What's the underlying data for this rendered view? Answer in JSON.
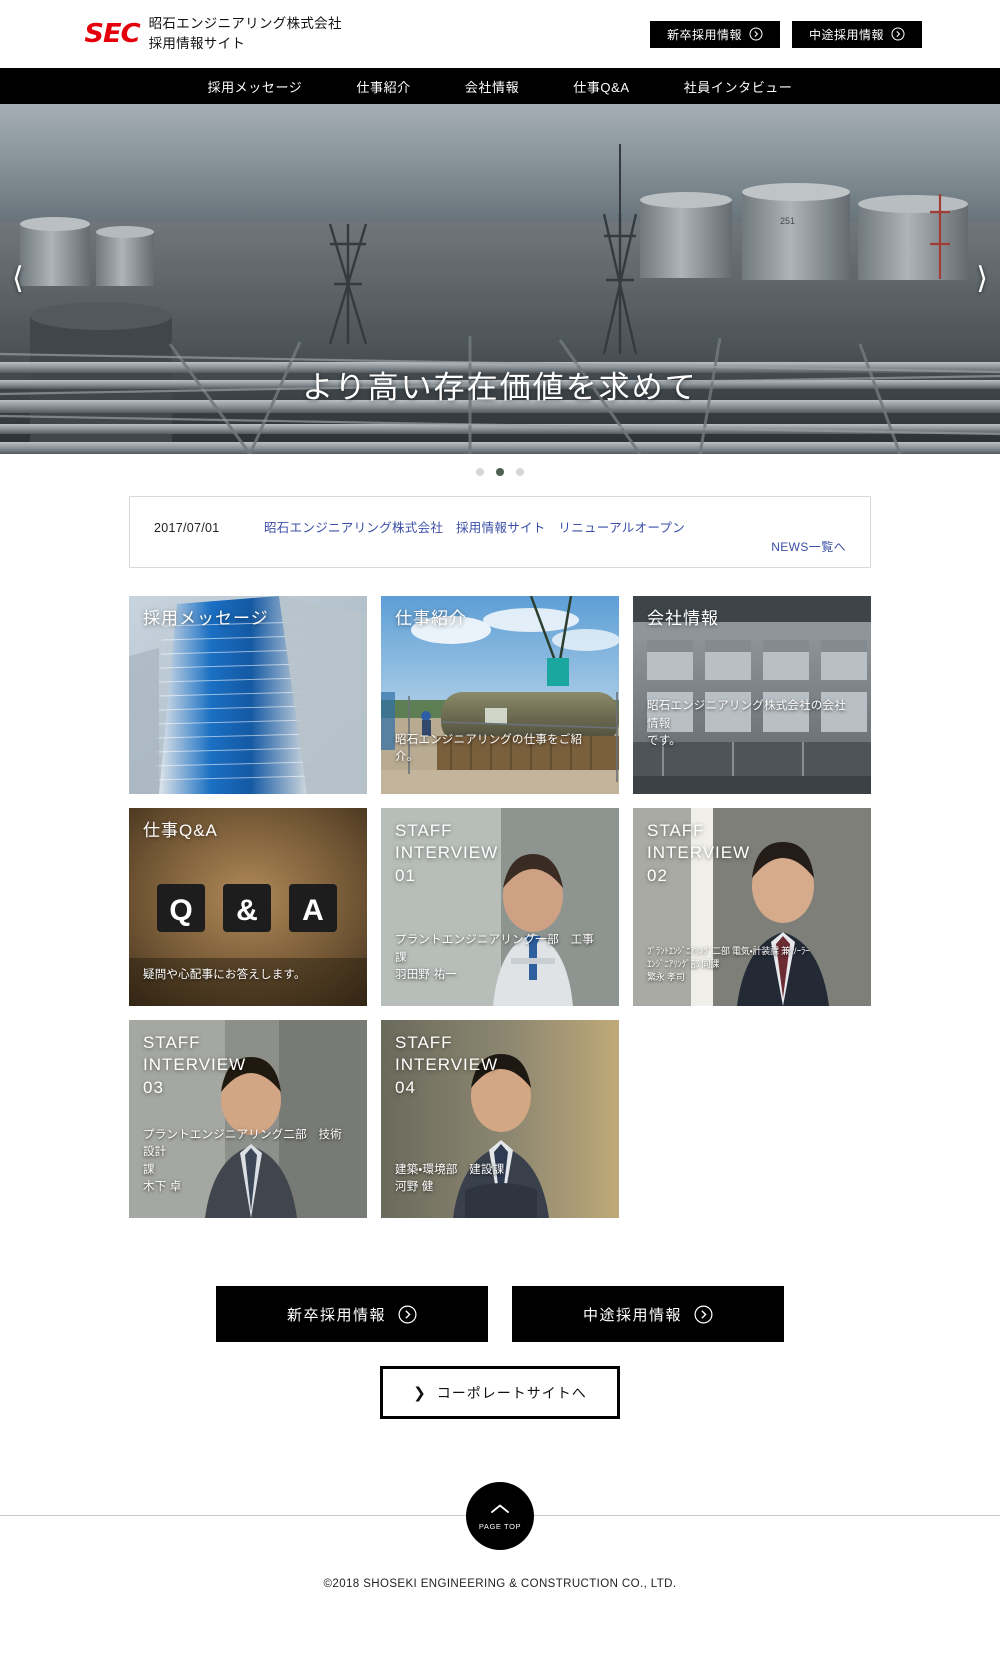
{
  "header": {
    "logo_mark": "SEC",
    "logo_line1": "昭石エンジニアリング株式会社",
    "logo_line2": "採用情報サイト",
    "buttons": [
      {
        "label": "新卒採用情報",
        "icon": "circle-arrow-right-icon"
      },
      {
        "label": "中途採用情報",
        "icon": "circle-arrow-right-icon"
      }
    ]
  },
  "nav": {
    "items": [
      {
        "label": "採用メッセージ"
      },
      {
        "label": "仕事紹介"
      },
      {
        "label": "会社情報"
      },
      {
        "label": "仕事Q&A"
      },
      {
        "label": "社員インタビュー"
      }
    ]
  },
  "hero": {
    "title": "より高い存在価値を求めて",
    "prev_icon": "chevron-left-icon",
    "next_icon": "chevron-right-icon",
    "slides": 3,
    "active_slide": 2
  },
  "news": {
    "date": "2017/07/01",
    "headline": "昭石エンジニアリング株式会社　採用情報サイト　リニューアルオープン",
    "all_link": "NEWS一覧へ",
    "link_color": "#3b4fa8"
  },
  "cards": [
    {
      "name": "recruit-message",
      "title": "採用メッセージ",
      "caption": ""
    },
    {
      "name": "job-introduction",
      "title": "仕事紹介",
      "caption": "昭石エンジニアリングの仕事をご紹介。"
    },
    {
      "name": "company-info",
      "title": "会社情報",
      "caption": "昭石エンジニアリング株式会社の会社情報\nです。"
    },
    {
      "name": "job-qa",
      "title": "仕事Q&A",
      "caption": "疑問や心配事にお答えします。"
    },
    {
      "name": "staff-interview-01",
      "title": "STAFF\nINTERVIEW\n01",
      "caption": "プラントエンジニアリング一部　工事課\n羽田野 祐一"
    },
    {
      "name": "staff-interview-02",
      "title": "STAFF\nINTERVIEW\n02",
      "caption": "ﾌﾟﾗﾝﾄｴﾝｼﾞﾆｱﾘﾝｸﾞ二部 電気・計装課 兼 ｿｰﾗｰ\nｴﾝｼﾞﾆｱﾘﾝｸﾞ部 同課\n繁永 孝司"
    },
    {
      "name": "staff-interview-03",
      "title": "STAFF\nINTERVIEW\n03",
      "caption": "プラントエンジニアリング二部　技術設計\n課\n木下 卓"
    },
    {
      "name": "staff-interview-04",
      "title": "STAFF\nINTERVIEW\n04",
      "caption": "建築・環境部　建設課\n河野 健"
    }
  ],
  "cta": {
    "buttons": [
      {
        "label": "新卒採用情報",
        "icon": "circle-arrow-right-icon"
      },
      {
        "label": "中途採用情報",
        "icon": "circle-arrow-right-icon"
      }
    ],
    "corporate": {
      "label": "コーポレートサイトへ",
      "icon": "chevron-right-icon"
    }
  },
  "footer": {
    "pagetop_label": "PAGE TOP",
    "pagetop_icon": "chevron-up-icon",
    "copyright": "©2018 SHOSEKI ENGINEERING & CONSTRUCTION CO., LTD."
  }
}
